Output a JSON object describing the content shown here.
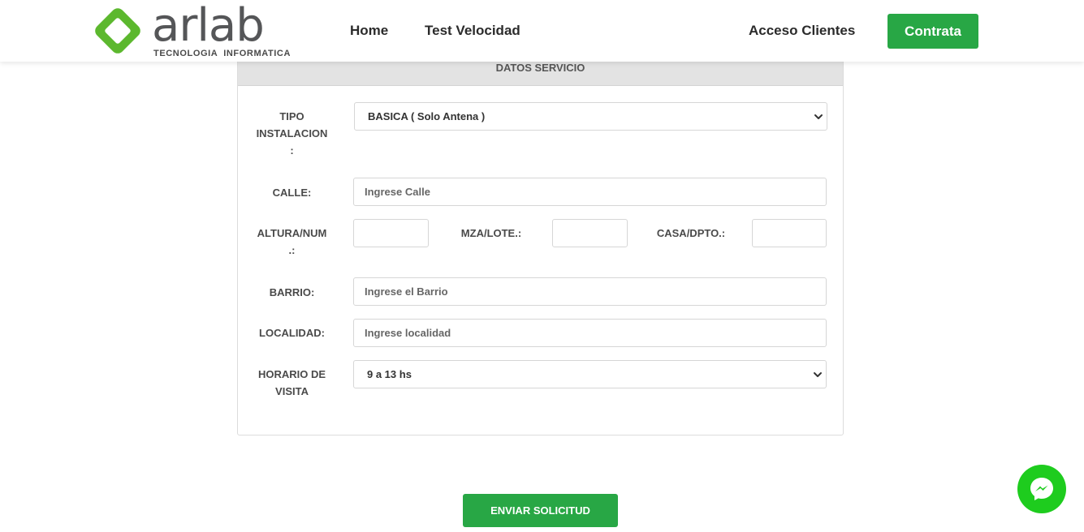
{
  "header": {
    "logo_text": "arlab",
    "logo_subtitle": "TECNOLOGIA  INFORMATICA",
    "nav": {
      "home": "Home",
      "test_velocidad": "Test Velocidad",
      "acceso_clientes": "Acceso Clientes"
    },
    "cta_label": "Contrata"
  },
  "form": {
    "section_title": "DATOS SERVICIO",
    "tipo_instalacion": {
      "label_line1": "TIPO",
      "label_line2": "INSTALACION",
      "label_line3": ":",
      "value": "BASICA ( Solo Antena )"
    },
    "calle": {
      "label": "CALLE:",
      "placeholder": "Ingrese Calle"
    },
    "altura": {
      "label_line1": "ALTURA/NUM",
      "label_line2": ".:"
    },
    "mza_lote": {
      "label": "MZA/LOTE.:"
    },
    "casa_dpto": {
      "label": "CASA/DPTO.:"
    },
    "barrio": {
      "label": "BARRIO:",
      "placeholder": "Ingrese el Barrio"
    },
    "localidad": {
      "label": "LOCALIDAD:",
      "placeholder": "Ingrese localidad"
    },
    "horario": {
      "label_line1": "HORARIO DE",
      "label_line2": "VISITA",
      "value": "9 a 13 hs"
    },
    "submit_label": "ENVIAR SOLICITUD"
  },
  "colors": {
    "accent_green": "#28a745",
    "logo_green": "#5cb82e",
    "messenger_green": "#1ecc1e"
  }
}
